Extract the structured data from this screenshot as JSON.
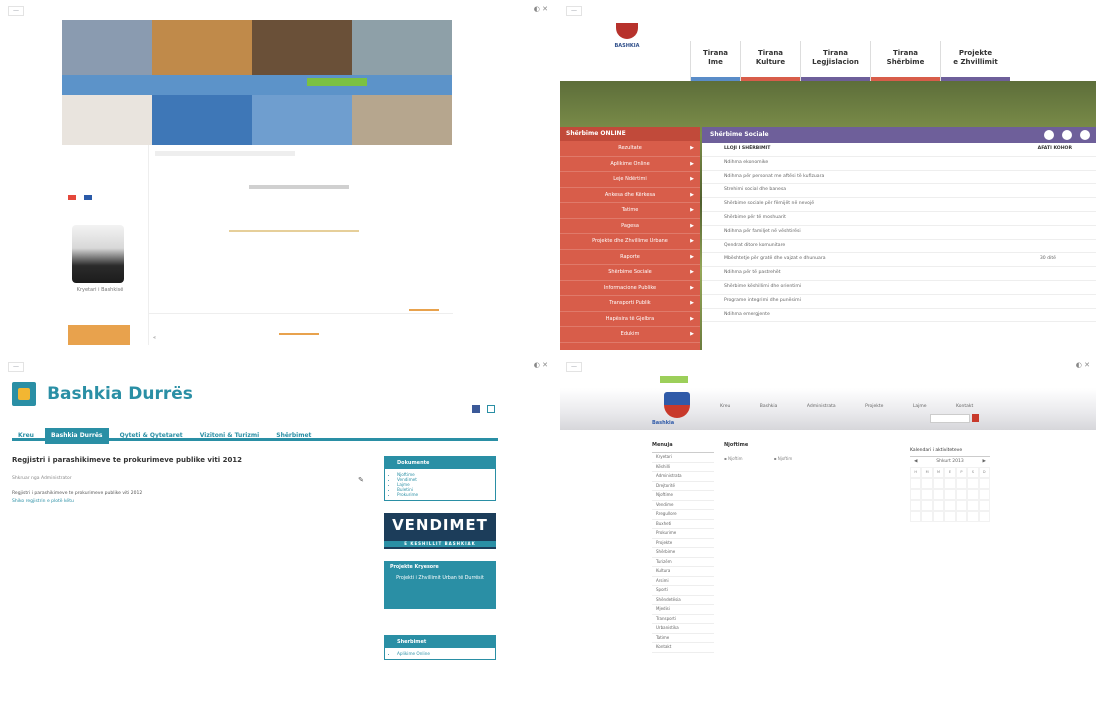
{
  "q1": {
    "caption": "Kryetari i Bashkisë",
    "pagination_prev": "«",
    "pagination_next": "»"
  },
  "q2": {
    "logo_text": "BASHKIA",
    "tabs": [
      {
        "label": "Tirana\nIme",
        "color": "#5a8cc8"
      },
      {
        "label": "Tirana\nKulture",
        "color": "#d85d4a"
      },
      {
        "label": "Tirana\nLegjislacion",
        "color": "#6e5f9a"
      },
      {
        "label": "Tirana\nShërbime",
        "color": "#d85d4a"
      },
      {
        "label": "Projekte\ne Zhvillimit",
        "color": "#6e5f9a"
      }
    ],
    "side_menu_title": "Shërbime ONLINE",
    "side_menu_items": [
      "Rezultate",
      "Aplikime Online",
      "Leje Ndërtimi",
      "Ankesa dhe Kërkesa",
      "Tatime",
      "Pagesa",
      "Projekte dhe Zhvillime Urbane",
      "Raporte",
      "Shërbime Sociale",
      "Informacione Publike",
      "Transporti Publik",
      "Hapësira të Gjelbra",
      "Edukim"
    ],
    "panel_title": "Shërbime Sociale",
    "table_header_left": "LLOJI I SHËRBIMIT",
    "table_header_right": "AFATI KOHOR",
    "rows": [
      {
        "text": "Ndihma ekonomike",
        "right": ""
      },
      {
        "text": "Ndihma për personat me aftësi të kufizuara",
        "right": ""
      },
      {
        "text": "Strehimi social dhe banesa",
        "right": ""
      },
      {
        "text": "Shërbime sociale për fëmijët në nevojë",
        "right": ""
      },
      {
        "text": "Shërbime për të moshuarit",
        "right": ""
      },
      {
        "text": "Ndihma për familjet në vështirësi",
        "right": ""
      },
      {
        "text": "Qendrat ditore komunitare",
        "right": ""
      },
      {
        "text": "Mbështetje për gratë dhe vajzat e dhunuara",
        "right": "30 ditë"
      },
      {
        "text": "Ndihma për të pastrehët",
        "right": ""
      },
      {
        "text": "Shërbime këshillimi dhe orientimi",
        "right": ""
      },
      {
        "text": "Programe integrimi dhe punësimi",
        "right": ""
      },
      {
        "text": "Ndihma emergjente",
        "right": ""
      }
    ]
  },
  "q3": {
    "logo": "Bashkia Durrës",
    "nav": [
      "Kreu",
      "Bashkia Durrës",
      "Qyteti & Qytetaret",
      "Vizitoni & Turizmi",
      "Shërbimet"
    ],
    "headline": "Regjistri i parashikimeve te prokurimeve publike viti 2012",
    "meta": "Shkruar nga Administrator",
    "paragraph": "Regjistri i parashikimeve te prokurimeve publike viti 2012",
    "link": "Shiko regjistrin e plotë këtu",
    "box1_title": "Dokumente",
    "box1_items": [
      "Njoftime",
      "Vendimet",
      "Lajme",
      "Buletini",
      "Prokurime"
    ],
    "vendimet": "VENDIMET",
    "vendimet_sub": "E KESHILLIT BASHKIAK",
    "tealbox_title": "Projekte Kryesore",
    "tealbox_text": "Projekti i Zhvillimit Urban të Durrësit",
    "box2_title": "Sherbimet",
    "box2_items": [
      "Aplikime Online"
    ]
  },
  "q4": {
    "brand": "Bashkia",
    "hlinks": [
      "Kreu",
      "Bashkia",
      "Administrata",
      "Projekte",
      "Lajme",
      "Kontakt"
    ],
    "left_title": "Menuja",
    "left_items": [
      "Kryetari",
      "Këshilli",
      "Administrata",
      "Drejtoritë",
      "Njoftime",
      "Vendime",
      "Rregullore",
      "Buxheti",
      "Prokurime",
      "Projekte",
      "Shërbime",
      "Turizëm",
      "Kultura",
      "Arsimi",
      "Sporti",
      "Shëndetësia",
      "Mjedisi",
      "Transporti",
      "Urbanistika",
      "Tatime",
      "Kontakt"
    ],
    "mid_title": "Njoftime",
    "mid_items": [
      "Njoftim",
      "Njoftim"
    ],
    "cal_title": "Kalendari i aktiviteteve",
    "cal_month": "Shkurt 2013",
    "cal_days": [
      "H",
      "M",
      "M",
      "E",
      "P",
      "S",
      "D"
    ]
  }
}
